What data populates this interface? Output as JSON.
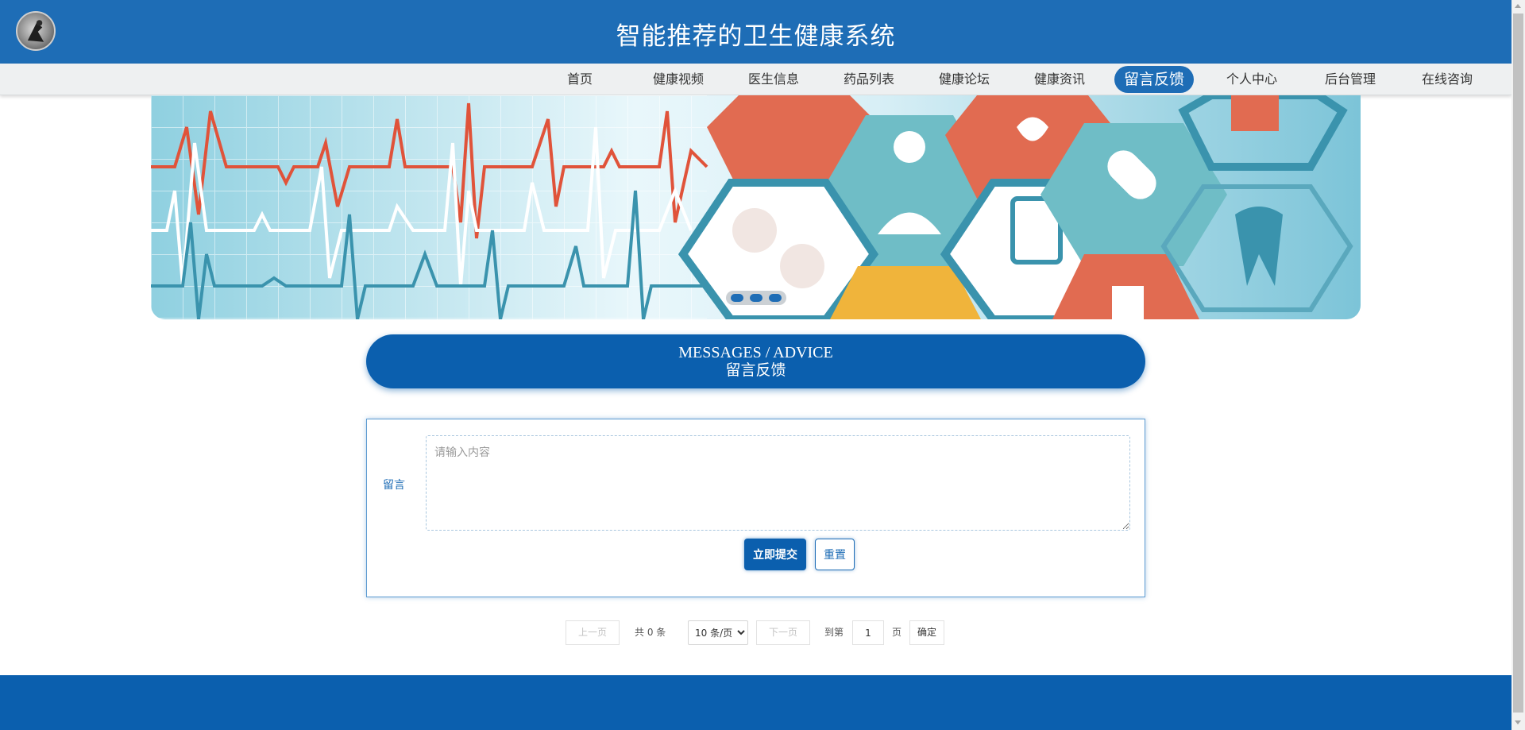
{
  "header": {
    "title": "智能推荐的卫生健康系统",
    "logo_icon": "user-avatar-icon"
  },
  "nav": {
    "items": [
      {
        "label": "首页",
        "active": false
      },
      {
        "label": "健康视频",
        "active": false
      },
      {
        "label": "医生信息",
        "active": false
      },
      {
        "label": "药品列表",
        "active": false
      },
      {
        "label": "健康论坛",
        "active": false
      },
      {
        "label": "健康资讯",
        "active": false
      },
      {
        "label": "留言反馈",
        "active": true
      },
      {
        "label": "个人中心",
        "active": false
      },
      {
        "label": "后台管理",
        "active": false
      },
      {
        "label": "在线咨询",
        "active": false
      }
    ]
  },
  "banner": {
    "slide_count": 3,
    "active_slide": 1
  },
  "section": {
    "title_en": "MESSAGES / ADVICE",
    "title_cn": "留言反馈"
  },
  "form": {
    "label": "留言",
    "textarea_placeholder": "请输入内容",
    "textarea_value": "",
    "submit_label": "立即提交",
    "reset_label": "重置"
  },
  "pagination": {
    "prev_label": "上一页",
    "total_text": "共 0 条",
    "page_size_options": [
      "10 条/页"
    ],
    "page_size_selected": "10 条/页",
    "next_label": "下一页",
    "goto_label": "到第",
    "page_value": "1",
    "page_unit": "页",
    "confirm_label": "确定"
  },
  "colors": {
    "primary": "#1e6db6",
    "primary_dark": "#0b5fae",
    "nav_bg": "#eef0f1"
  }
}
